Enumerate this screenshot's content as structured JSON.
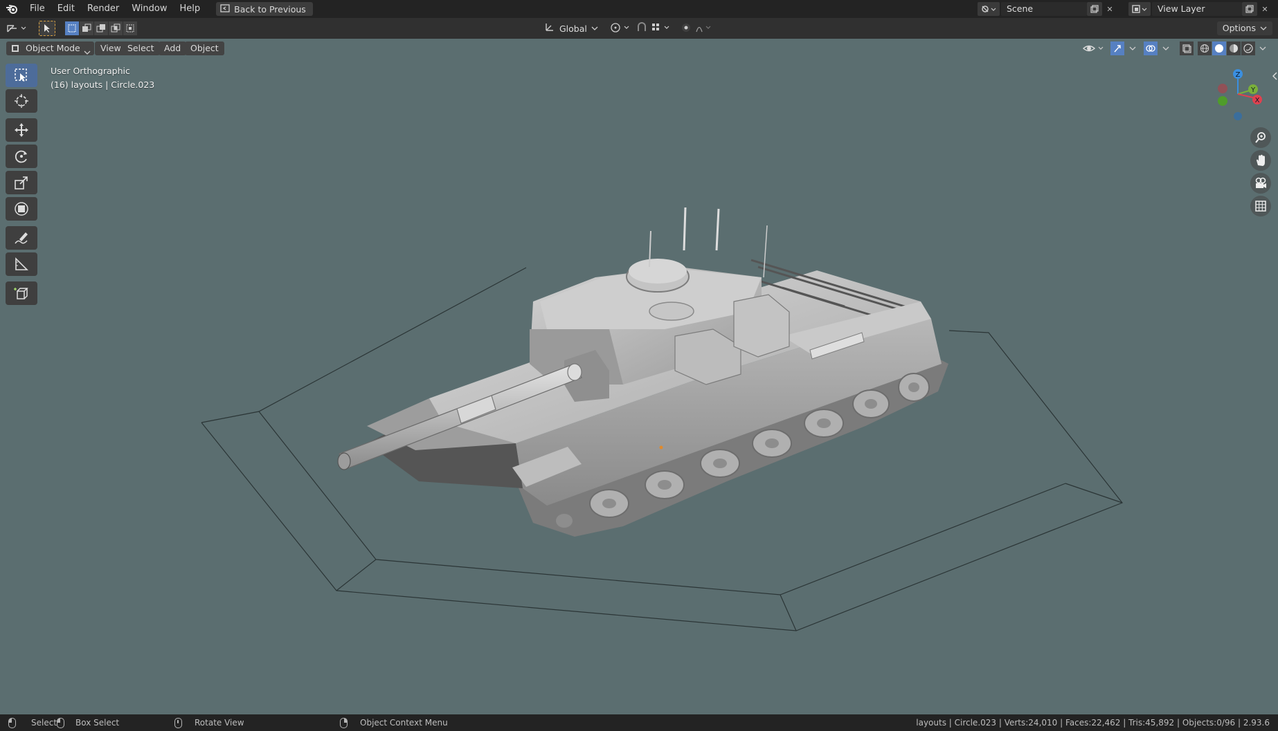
{
  "topbar": {
    "menus": [
      "File",
      "Edit",
      "Render",
      "Window",
      "Help"
    ],
    "back_label": "Back to Previous",
    "scene_value": "Scene",
    "view_layer_value": "View Layer"
  },
  "toolheader": {
    "orientation": "Global",
    "options_label": "Options"
  },
  "viewport_header": {
    "mode": "Object Mode",
    "menus": [
      "View",
      "Select",
      "Add",
      "Object"
    ]
  },
  "overlay": {
    "view_name": "User Orthographic",
    "collection_info": "(16) layouts | Circle.023"
  },
  "gizmo": {
    "z": "Z",
    "y": "Y",
    "x": "X"
  },
  "statusbar": {
    "select": "Select",
    "box_select": "Box Select",
    "rotate_view": "Rotate View",
    "context_menu": "Object Context Menu",
    "stats": "layouts | Circle.023 | Verts:24,010 | Faces:22,462 | Tris:45,892 | Objects:0/96 | 2.93.6"
  },
  "icons": {
    "logo": "blender-logo-icon",
    "tools": [
      "select-box-icon",
      "cursor-icon",
      "move-icon",
      "rotate-icon",
      "scale-icon",
      "transform-icon",
      "annotate-icon",
      "measure-icon",
      "add-cube-icon"
    ],
    "nav": [
      "zoom-icon",
      "pan-hand-icon",
      "camera-icon",
      "grid-icon"
    ]
  },
  "colors": {
    "viewport_bg": "#5b6e70",
    "active_tool": "#4d6c9a",
    "axis_x": "#e0414f",
    "axis_y": "#7ab03a",
    "axis_z": "#3b8fe0"
  }
}
